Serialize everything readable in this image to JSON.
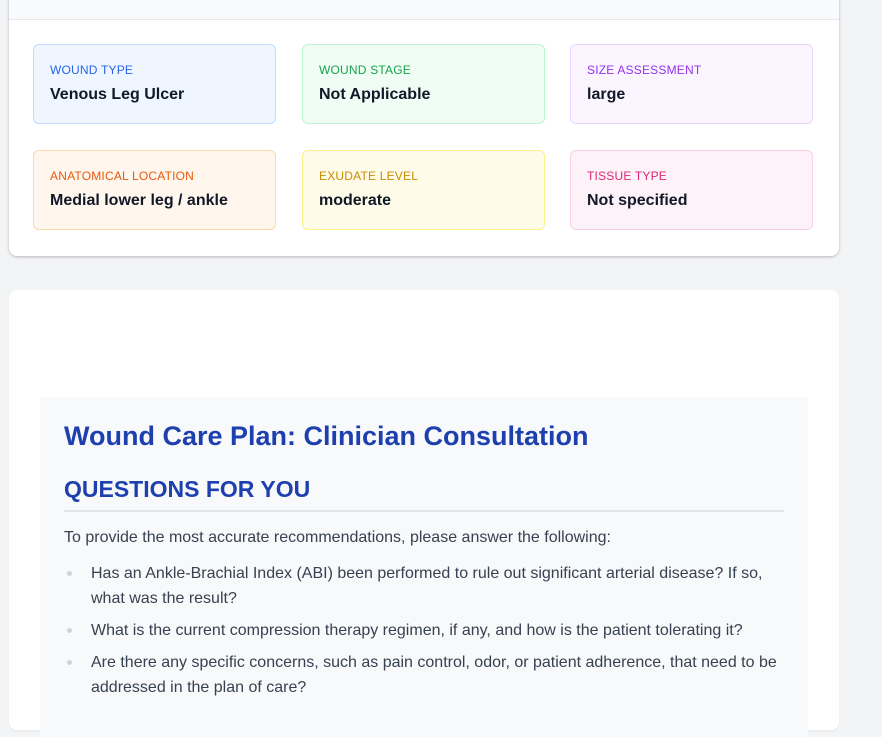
{
  "summary": {
    "tiles": [
      {
        "label": "WOUND TYPE",
        "value": "Venous Leg Ulcer"
      },
      {
        "label": "WOUND STAGE",
        "value": "Not Applicable"
      },
      {
        "label": "SIZE ASSESSMENT",
        "value": "large"
      },
      {
        "label": "ANATOMICAL LOCATION",
        "value": "Medial lower leg / ankle"
      },
      {
        "label": "EXUDATE LEVEL",
        "value": "moderate"
      },
      {
        "label": "TISSUE TYPE",
        "value": "Not specified"
      }
    ],
    "colors": {
      "wound_type": "#2563eb",
      "wound_stage": "#16a34a",
      "size_assessment": "#9333ea",
      "anatomical_location": "#ea580c",
      "exudate_level": "#ca8a04",
      "tissue_type": "#db2777"
    }
  },
  "plan": {
    "title": "Wound Care Plan: Clinician Consultation",
    "section_heading": "QUESTIONS FOR YOU",
    "intro": "To provide the most accurate recommendations, please answer the following:",
    "questions": [
      "Has an Ankle-Brachial Index (ABI) been performed to rule out significant arterial disease? If so, what was the result?",
      "What is the current compression therapy regimen, if any, and how is the patient tolerating it?",
      "Are there any specific concerns, such as pain control, odor, or patient adherence, that need to be addressed in the plan of care?"
    ],
    "accent_color": "#1e40af"
  }
}
